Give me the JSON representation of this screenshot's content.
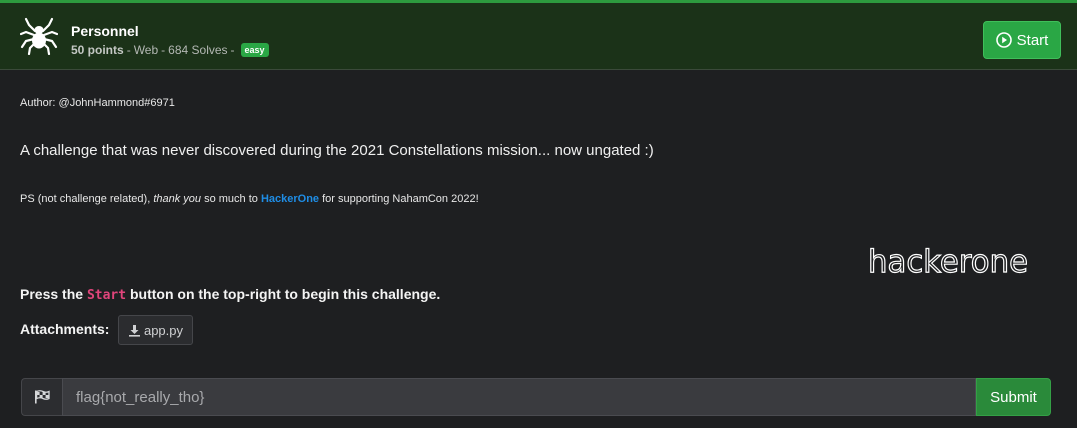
{
  "challenge": {
    "title": "Personnel",
    "points": "50 points",
    "category": "Web",
    "solves": "684 Solves",
    "difficulty": "easy",
    "start_label": "Start"
  },
  "description": {
    "author": "Author: @JohnHammond#6971",
    "summary": "A challenge that was never discovered during the 2021 Constellations mission... now ungated :)",
    "ps_prefix": "PS (not challenge related), ",
    "ps_emphasis": "thank you",
    "ps_middle": " so much to ",
    "ps_link": "HackerOne",
    "ps_suffix": " for supporting NahamCon 2022!",
    "logo_text": "hackerone",
    "press_prefix": "Press the ",
    "press_code": "Start",
    "press_suffix": " button on the top-right to begin this challenge.",
    "attachments_label": "Attachments:",
    "attachment_file": "app.py"
  },
  "flag_form": {
    "placeholder": "flag{not_really_tho}",
    "submit_label": "Submit"
  },
  "icons": {
    "category": "spider-icon",
    "start": "play-circle-icon",
    "download": "download-icon",
    "flag": "flag-checkered-icon"
  },
  "colors": {
    "header_bg": "#1b3218",
    "accent_green": "#2aa745",
    "link_blue": "#1f8de5",
    "code_pink": "#e0457b"
  }
}
